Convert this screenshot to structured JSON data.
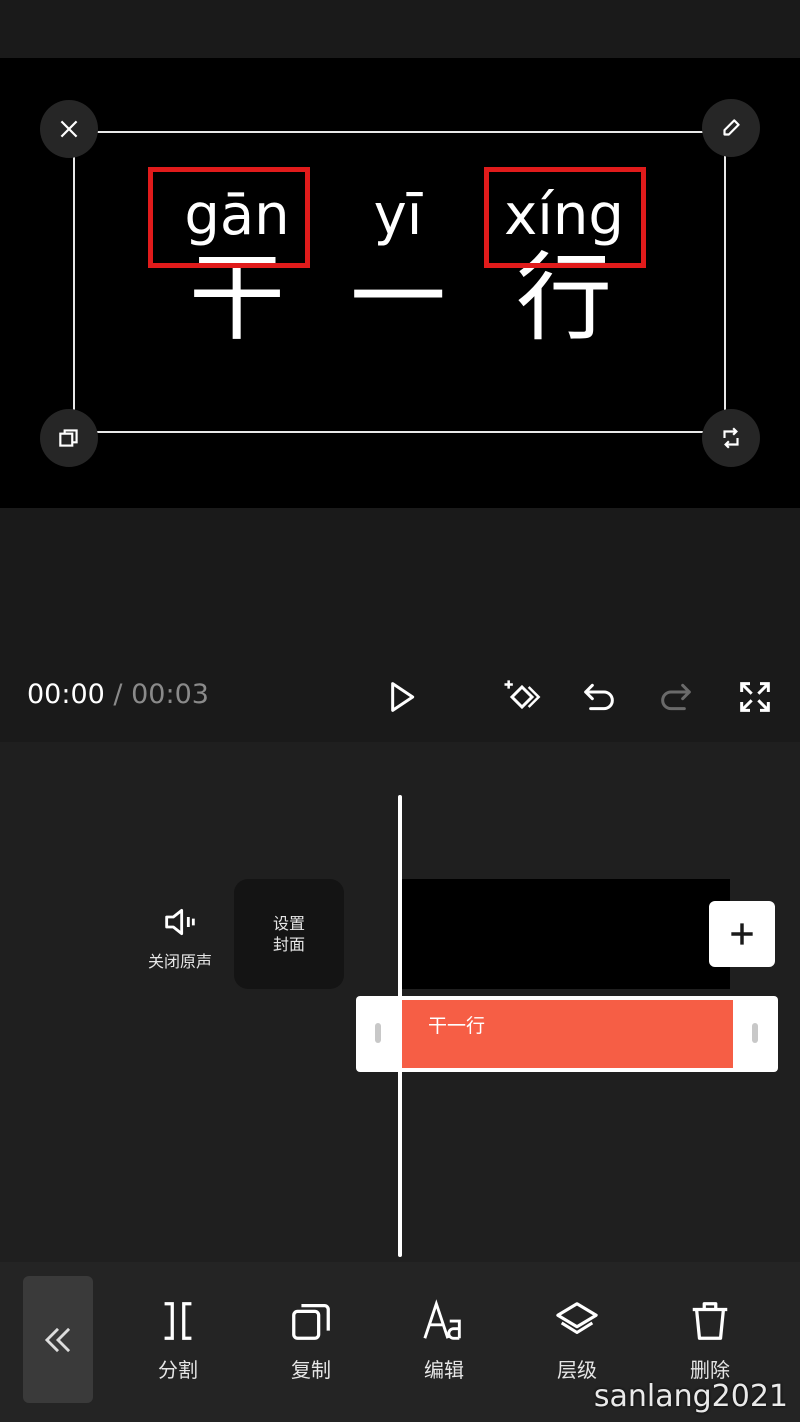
{
  "preview": {
    "words": [
      {
        "pinyin": "gān",
        "hanzi": "干"
      },
      {
        "pinyin": "yī",
        "hanzi": "一"
      },
      {
        "pinyin": "xíng",
        "hanzi": "行"
      }
    ]
  },
  "player": {
    "current_time": "00:00",
    "separator": "/",
    "total_time": "00:03"
  },
  "timeline": {
    "mute_label": "关闭原声",
    "cover_label_line1": "设置",
    "cover_label_line2": "封面",
    "text_clip_label": "干一行"
  },
  "toolbar": {
    "items": [
      {
        "label": "分割",
        "icon": "split-icon"
      },
      {
        "label": "复制",
        "icon": "copy-icon"
      },
      {
        "label": "编辑",
        "icon": "text-edit-icon"
      },
      {
        "label": "层级",
        "icon": "layers-icon"
      },
      {
        "label": "删除",
        "icon": "trash-icon"
      }
    ]
  },
  "watermark": "sanlang2021",
  "colors": {
    "accent_clip": "#f65e45",
    "highlight_box": "#e01b1b",
    "background": "#1a1a1a"
  }
}
